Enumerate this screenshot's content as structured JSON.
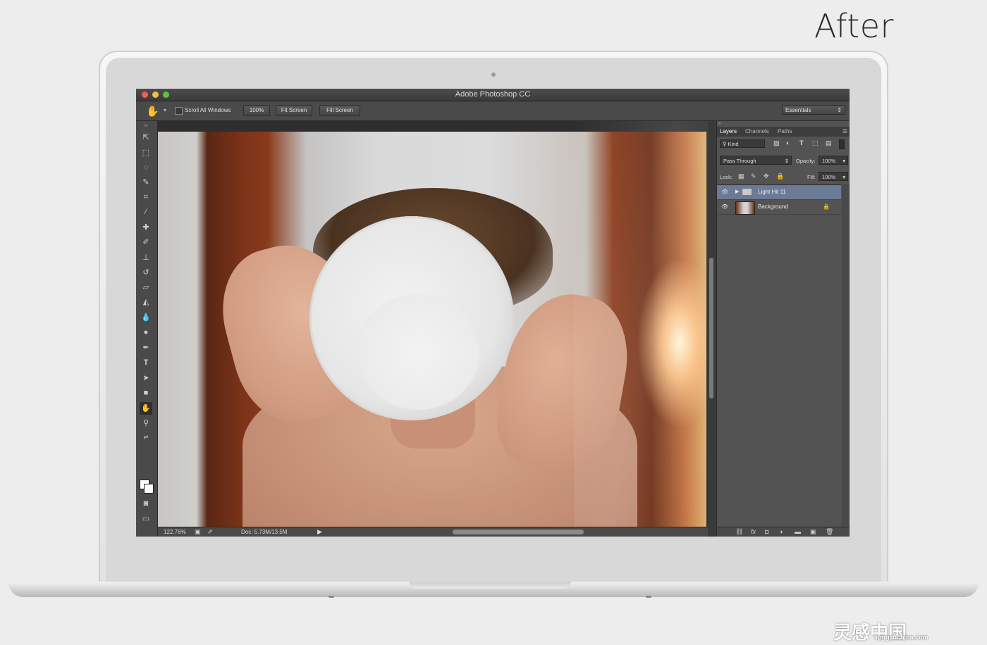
{
  "header": {
    "label": "After"
  },
  "window": {
    "title": "Adobe Photoshop CC"
  },
  "options_bar": {
    "scroll_all_label": "Scroll All Windows",
    "zoom_100_label": "100%",
    "fit_screen_label": "Fit Screen",
    "fill_screen_label": "Fill Screen",
    "workspace_label": "Essentials"
  },
  "layers_panel": {
    "tabs": [
      "Layers",
      "Channels",
      "Paths"
    ],
    "filter_kind": "Kind",
    "blend_mode": "Pass Through",
    "opacity_label": "Opacity:",
    "opacity_value": "100%",
    "lock_label": "Lock:",
    "fill_label": "Fill:",
    "fill_value": "100%",
    "layers": [
      {
        "name": "Light Hit 11",
        "type": "group",
        "selected": true
      },
      {
        "name": "Background",
        "type": "image",
        "locked": true
      }
    ]
  },
  "status_bar": {
    "zoom": "122.76%",
    "doc": "Doc: 5.73M/13.5M"
  },
  "watermark": {
    "text": "灵感中国",
    "sub": "lingganchina.com"
  },
  "icons": {
    "tools": [
      "move-icon",
      "marquee-icon",
      "lasso-icon",
      "quick-select-icon",
      "crop-icon",
      "eyedropper-icon",
      "healing-icon",
      "brush-icon",
      "stamp-icon",
      "history-brush-icon",
      "eraser-icon",
      "paint-bucket-icon",
      "blur-icon",
      "dodge-icon",
      "pen-icon",
      "type-icon",
      "path-select-icon",
      "rectangle-icon",
      "hand-icon",
      "zoom-icon"
    ]
  }
}
